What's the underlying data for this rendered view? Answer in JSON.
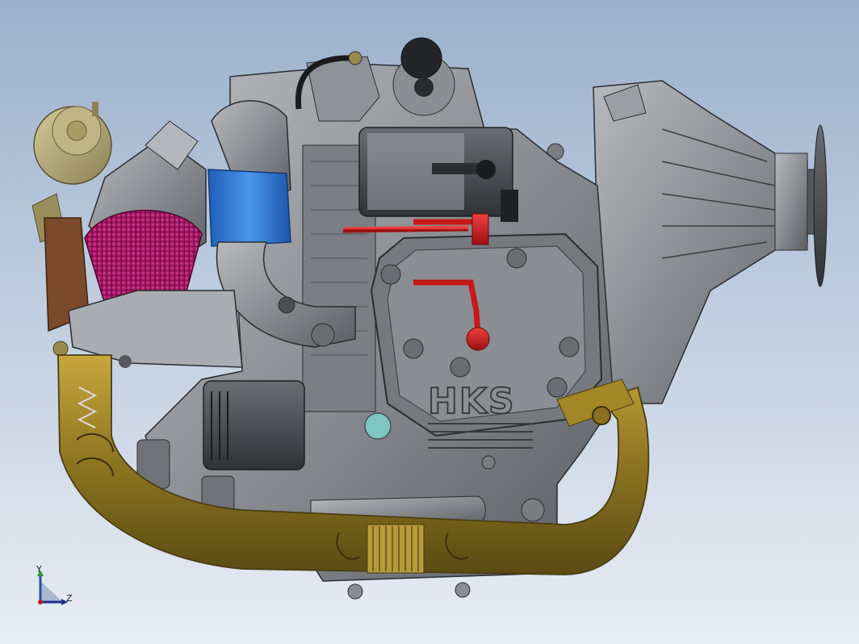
{
  "viewport": {
    "background_top": "#9cb0cc",
    "background_bottom": "#e9edf4"
  },
  "model": {
    "description_free": true,
    "logo_text": "HKS",
    "colors": {
      "engine_gray": "#8a8d92",
      "engine_dark": "#45484d",
      "exhaust_gold": "#8c7420",
      "intake_blue": "#2f7ad8",
      "filter_magenta": "#c3167a",
      "fuel_line_red": "#d11e1e",
      "wastegate_olive": "#a69b6b",
      "manifold_brown": "#7a4a2a",
      "sensor_teal": "#7fc5c2"
    }
  },
  "triad": {
    "y_label": "Y",
    "z_label": "Z"
  }
}
